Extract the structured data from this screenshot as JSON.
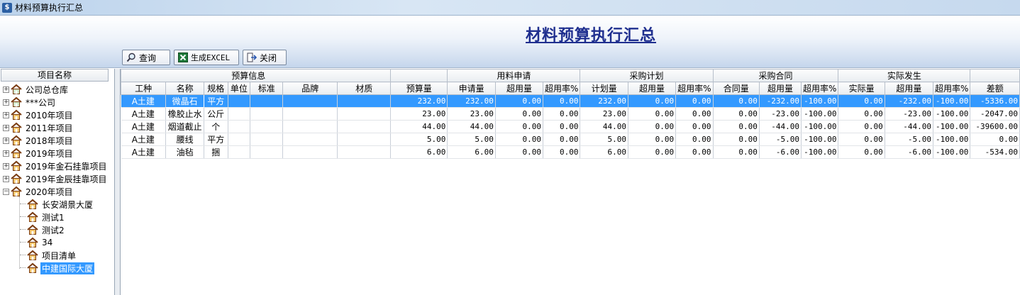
{
  "window": {
    "title": "材料预算执行汇总"
  },
  "page": {
    "title": "材料预算执行汇总"
  },
  "toolbar": {
    "query_label": "查询",
    "excel_label": "生成EXCEL",
    "close_label": "关闭"
  },
  "tree": {
    "header": "项目名称",
    "items": [
      {
        "label": "公司总仓库"
      },
      {
        "label": "***公司"
      },
      {
        "label": "2010年项目"
      },
      {
        "label": "2011年项目"
      },
      {
        "label": "2018年项目"
      },
      {
        "label": "2019年项目"
      },
      {
        "label": "2019年金石挂靠项目"
      },
      {
        "label": "2019年金辰挂靠项目"
      },
      {
        "label": "2020年项目"
      },
      {
        "label": "长安湖景大厦"
      },
      {
        "label": "测试1"
      },
      {
        "label": "测试2"
      },
      {
        "label": "34"
      },
      {
        "label": "项目清单"
      },
      {
        "label": "中建国际大厦"
      }
    ]
  },
  "table": {
    "groups": [
      "预算信息",
      "用料申请",
      "采购计划",
      "采购合同",
      "实际发生"
    ],
    "columns": [
      "工种",
      "名称",
      "规格",
      "单位",
      "标准",
      "品牌",
      "材质",
      "预算量",
      "申请量",
      "超用量",
      "超用率%",
      "计划量",
      "超用量",
      "超用率%",
      "合同量",
      "超用量",
      "超用率%",
      "实际量",
      "超用量",
      "超用率%",
      "差额"
    ],
    "rows": [
      [
        "A土建",
        "微晶石",
        "平方",
        "",
        "",
        "",
        "",
        "232.00",
        "232.00",
        "0.00",
        "0.00",
        "232.00",
        "0.00",
        "0.00",
        "0.00",
        "-232.00",
        "-100.00",
        "0.00",
        "-232.00",
        "-100.00",
        "-5336.00"
      ],
      [
        "A土建",
        "橡胶止水",
        "公斤",
        "",
        "",
        "",
        "",
        "23.00",
        "23.00",
        "0.00",
        "0.00",
        "23.00",
        "0.00",
        "0.00",
        "0.00",
        "-23.00",
        "-100.00",
        "0.00",
        "-23.00",
        "-100.00",
        "-2047.00"
      ],
      [
        "A土建",
        "烟道截止",
        "个",
        "",
        "",
        "",
        "",
        "44.00",
        "44.00",
        "0.00",
        "0.00",
        "44.00",
        "0.00",
        "0.00",
        "0.00",
        "-44.00",
        "-100.00",
        "0.00",
        "-44.00",
        "-100.00",
        "-39600.00"
      ],
      [
        "A土建",
        "腰线",
        "平方",
        "",
        "",
        "",
        "",
        "5.00",
        "5.00",
        "0.00",
        "0.00",
        "5.00",
        "0.00",
        "0.00",
        "0.00",
        "-5.00",
        "-100.00",
        "0.00",
        "-5.00",
        "-100.00",
        "0.00"
      ],
      [
        "A土建",
        "油毡",
        "捆",
        "",
        "",
        "",
        "",
        "6.00",
        "6.00",
        "0.00",
        "0.00",
        "6.00",
        "0.00",
        "0.00",
        "0.00",
        "-6.00",
        "-100.00",
        "0.00",
        "-6.00",
        "-100.00",
        "-534.00"
      ]
    ]
  }
}
